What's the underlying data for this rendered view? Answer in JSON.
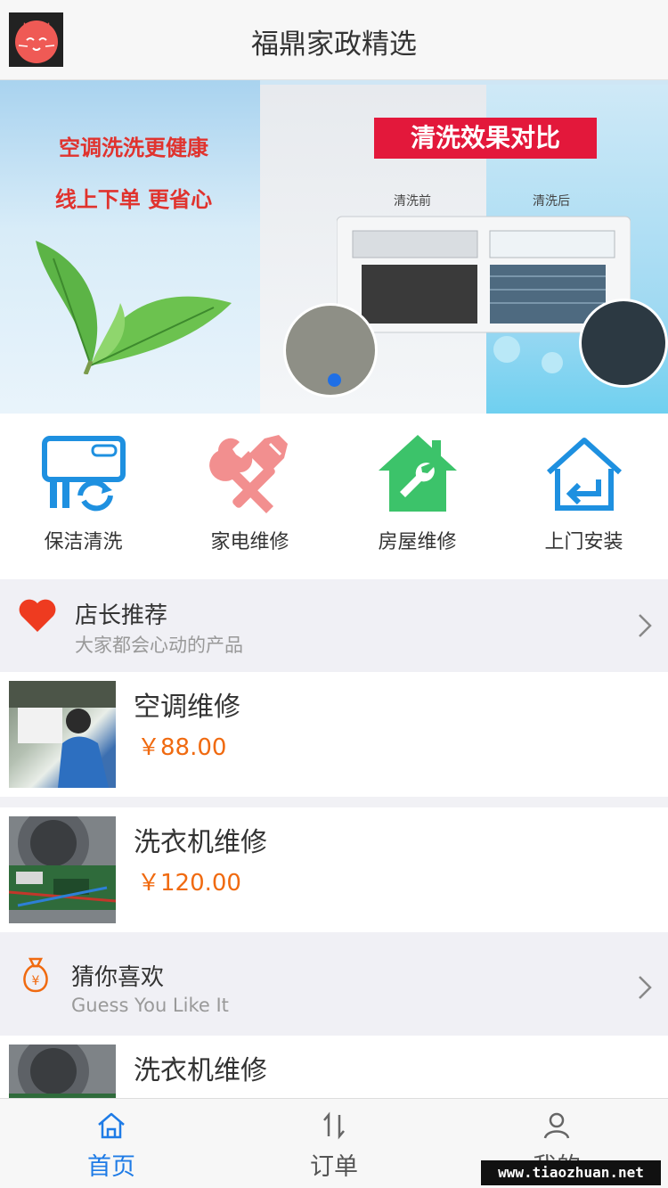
{
  "header": {
    "title": "福鼎家政精选",
    "logo_icon": "cat-logo-icon"
  },
  "banner": {
    "slogan_line1": "空调洗洗更健康",
    "slogan_line2": "线上下单 更省心",
    "compare_title": "清洗效果对比",
    "before_label": "清洗前",
    "after_label": "清洗后",
    "active_slide": 1
  },
  "categories": [
    {
      "label": "保洁清洗",
      "icon": "air-conditioner-icon"
    },
    {
      "label": "家电维修",
      "icon": "tools-icon"
    },
    {
      "label": "房屋维修",
      "icon": "house-wrench-icon"
    },
    {
      "label": "上门安装",
      "icon": "home-return-icon"
    }
  ],
  "recommend": {
    "title": "店长推荐",
    "subtitle": "大家都会心动的产品",
    "icon": "heart-icon",
    "items": [
      {
        "name": "空调维修",
        "price": "￥88.00"
      },
      {
        "name": "洗衣机维修",
        "price": "￥120.00"
      }
    ]
  },
  "guess": {
    "title": "猜你喜欢",
    "subtitle": "Guess You Like It",
    "icon": "money-bag-icon",
    "items": [
      {
        "name": "洗衣机维修"
      }
    ]
  },
  "tabbar": {
    "tabs": [
      {
        "label": "首页",
        "icon": "home-icon"
      },
      {
        "label": "订单",
        "icon": "sort-icon"
      },
      {
        "label": "我的",
        "icon": "user-icon"
      }
    ]
  },
  "watermark": "www.tiaozhuan.net",
  "colors": {
    "accent": "#1e7be6",
    "price": "#f06a10",
    "heart": "#ee3b20",
    "house": "#3cc36a",
    "tools": "#f28f8f"
  }
}
